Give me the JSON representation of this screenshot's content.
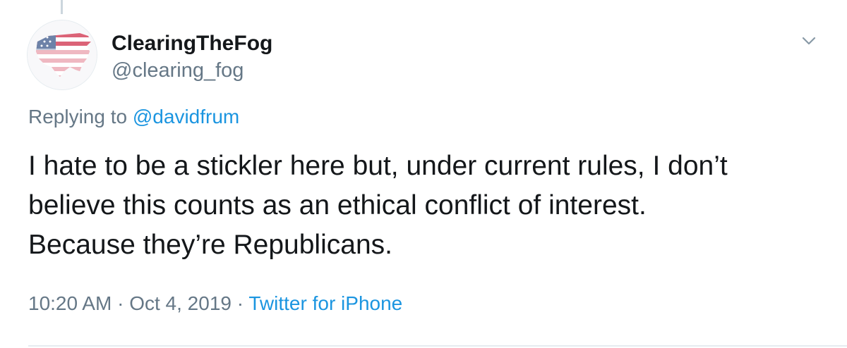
{
  "tweet": {
    "display_name": "ClearingTheFog",
    "handle": "@clearing_fog",
    "replying_prefix": "Replying to",
    "replying_to": "@davidfrum",
    "text_lines": [
      "I hate to be a stickler here but, under current rules, I don’t",
      "believe this counts as an ethical conflict of interest.",
      "Because they’re Republicans."
    ],
    "time": "10:20 AM",
    "separator": "·",
    "date": "Oct 4, 2019",
    "source": "Twitter for iPhone"
  },
  "icons": {
    "avatar": "us-map-flag-avatar",
    "menu": "chevron-down-icon"
  },
  "colors": {
    "link": "#1b95e0",
    "secondary_text": "#657786",
    "primary_text": "#14171a",
    "border": "#e6ecf0"
  }
}
